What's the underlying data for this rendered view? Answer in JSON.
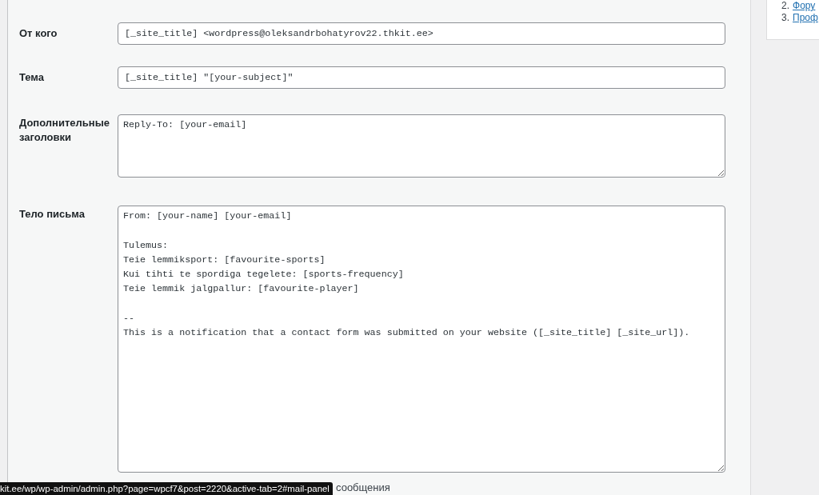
{
  "sidebar": {
    "items": [
      {
        "number": "2.",
        "label": "Фору"
      },
      {
        "number": "3.",
        "label": "Проф"
      }
    ]
  },
  "mail_fields": [
    {
      "kind": "input",
      "label": "От кого",
      "value": "[_site_title] <wordpress@oleksandrbohatyrov22.thkit.ee>"
    },
    {
      "kind": "input",
      "label": "Тема",
      "value": "[_site_title] \"[your-subject]\""
    },
    {
      "kind": "textarea",
      "label": "Дополнительные заголовки",
      "value": "Reply-To: [your-email]"
    },
    {
      "kind": "body",
      "label": "Тело письма",
      "value": "From: [your-name] [your-email]\n\nTulemus:\nTeie lemmiksport: [favourite-sports]\nKui tihti te spordiga tegelete: [sports-frequency]\nTeie lemmik jalgpallur: [favourite-player]\n\n--\nThis is a notification that a contact form was submitted on your website ([_site_title] [_site_url])."
    }
  ],
  "option_label": "сообщения",
  "status_bar": {
    "url": "kit.ee/wp/wp-admin/admin.php?page=wpcf7&post=2220&active-tab=2#mail-panel"
  }
}
